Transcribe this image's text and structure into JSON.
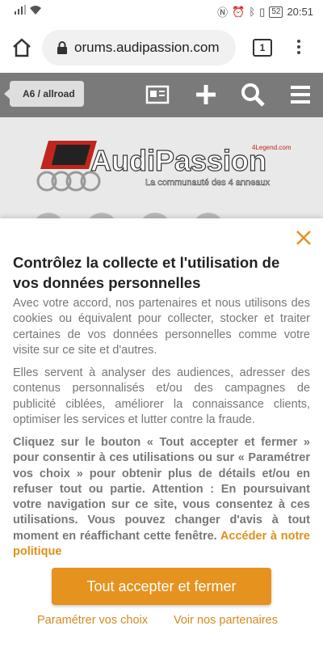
{
  "status": {
    "time": "20:51",
    "battery": "52"
  },
  "browser": {
    "url": "orums.audipassion.com",
    "tab_count": "1"
  },
  "site": {
    "breadcrumb": "A6 / allroad",
    "logo_text": "AudiPassion",
    "logo_tagline": "La communauté des 4 anneaux",
    "logo_badge": "4Legend.com"
  },
  "consent": {
    "title": "Contrôlez la collecte et l'utilisation de vos données personnelles",
    "p1": "Avec votre accord, nos partenaires et nous utilisons des cookies ou équivalent pour collecter, stocker et traiter certaines de vos données personnelles comme votre visite sur ce site et d'autres.",
    "p2": "Elles servent à analyser des audiences, adresser des contenus personnalisés et/ou des campagnes de publicité ciblées, améliorer la connaissance clients, optimiser les services et lutter contre la fraude.",
    "p3": "Cliquez sur le bouton « Tout accepter et fermer » pour consentir à ces utilisations ou sur « Paramétrer vos choix » pour obtenir plus de détails et/ou en refuser tout ou partie. Attention : En poursuivant votre navigation sur ce site, vous consentez à ces utilisations. Vous pouvez changer d'avis à tout moment en réaffichant cette fenêtre.",
    "policy_link": "Accéder à notre politique",
    "accept_label": "Tout accepter et fermer",
    "settings_label": "Paramétrer vos choix",
    "partners_label": "Voir nos partenaires"
  },
  "colors": {
    "accent": "#e6921e",
    "site_bar": "#7a7a7a"
  }
}
